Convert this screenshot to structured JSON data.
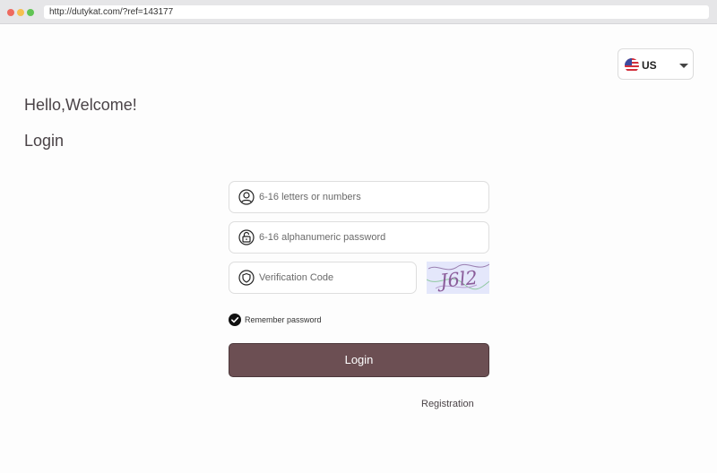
{
  "browser": {
    "url": "http://dutykat.com/?ref=143177"
  },
  "language": {
    "code": "US",
    "flag_icon": "us-flag-icon"
  },
  "heading": {
    "greeting": "Hello,Welcome!",
    "title": "Login"
  },
  "form": {
    "username_placeholder": "6-16 letters or numbers",
    "password_placeholder": "6-16 alphanumeric password",
    "code_placeholder": "Verification Code",
    "captcha_text": "J6l2",
    "remember_label": "Remember password",
    "remember_checked": true,
    "login_label": "Login",
    "registration_label": "Registration"
  },
  "colors": {
    "accent": "#6c4f53",
    "captcha_bg": "#e4e7fb"
  }
}
